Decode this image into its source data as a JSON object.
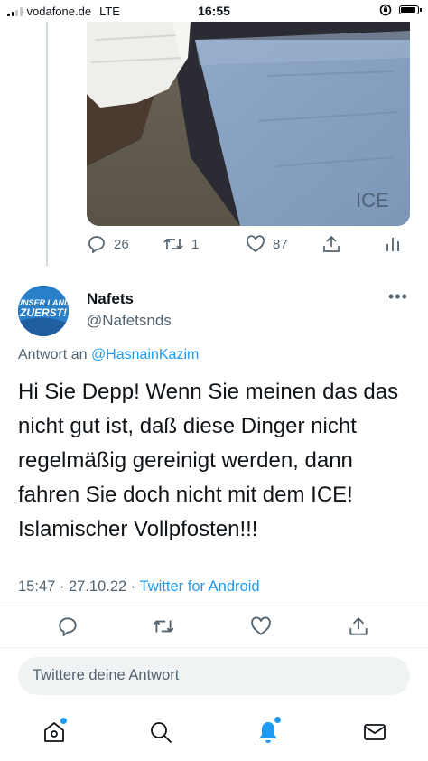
{
  "status_bar": {
    "carrier": "vodafone.de",
    "network": "LTE",
    "time": "16:55"
  },
  "quoted_tweet_actions": {
    "replies": "26",
    "retweets": "1",
    "likes": "87"
  },
  "photo": {
    "seat_text": "ICE"
  },
  "tweet": {
    "avatar_text_line1": "UNSER LAND",
    "avatar_text_line2": "ZUERST!",
    "author_name": "Nafets",
    "author_handle": "@Nafetsnds",
    "more_label": "•••",
    "reply_prefix": "Antwort an",
    "reply_to": "@HasnainKazim",
    "text": "Hi Sie Depp! Wenn Sie meinen das das nicht gut ist, daß diese Dinger nicht regelmäßig gereinigt werden, dann fahren Sie doch nicht mit dem ICE! Islamischer Vollpfosten!!!",
    "timestamp": "15:47 · 27.10.22 ·",
    "source": "Twitter for Android"
  },
  "reply_box": {
    "placeholder": "Twittere deine Antwort"
  },
  "colors": {
    "accent": "#1d9bf0",
    "secondary_text": "#536471",
    "avatar_bg": "#2a7fc9"
  },
  "icons": [
    "reply-icon",
    "retweet-icon",
    "like-icon",
    "share-icon",
    "analytics-icon",
    "home-icon",
    "search-icon",
    "notifications-icon",
    "messages-icon"
  ]
}
